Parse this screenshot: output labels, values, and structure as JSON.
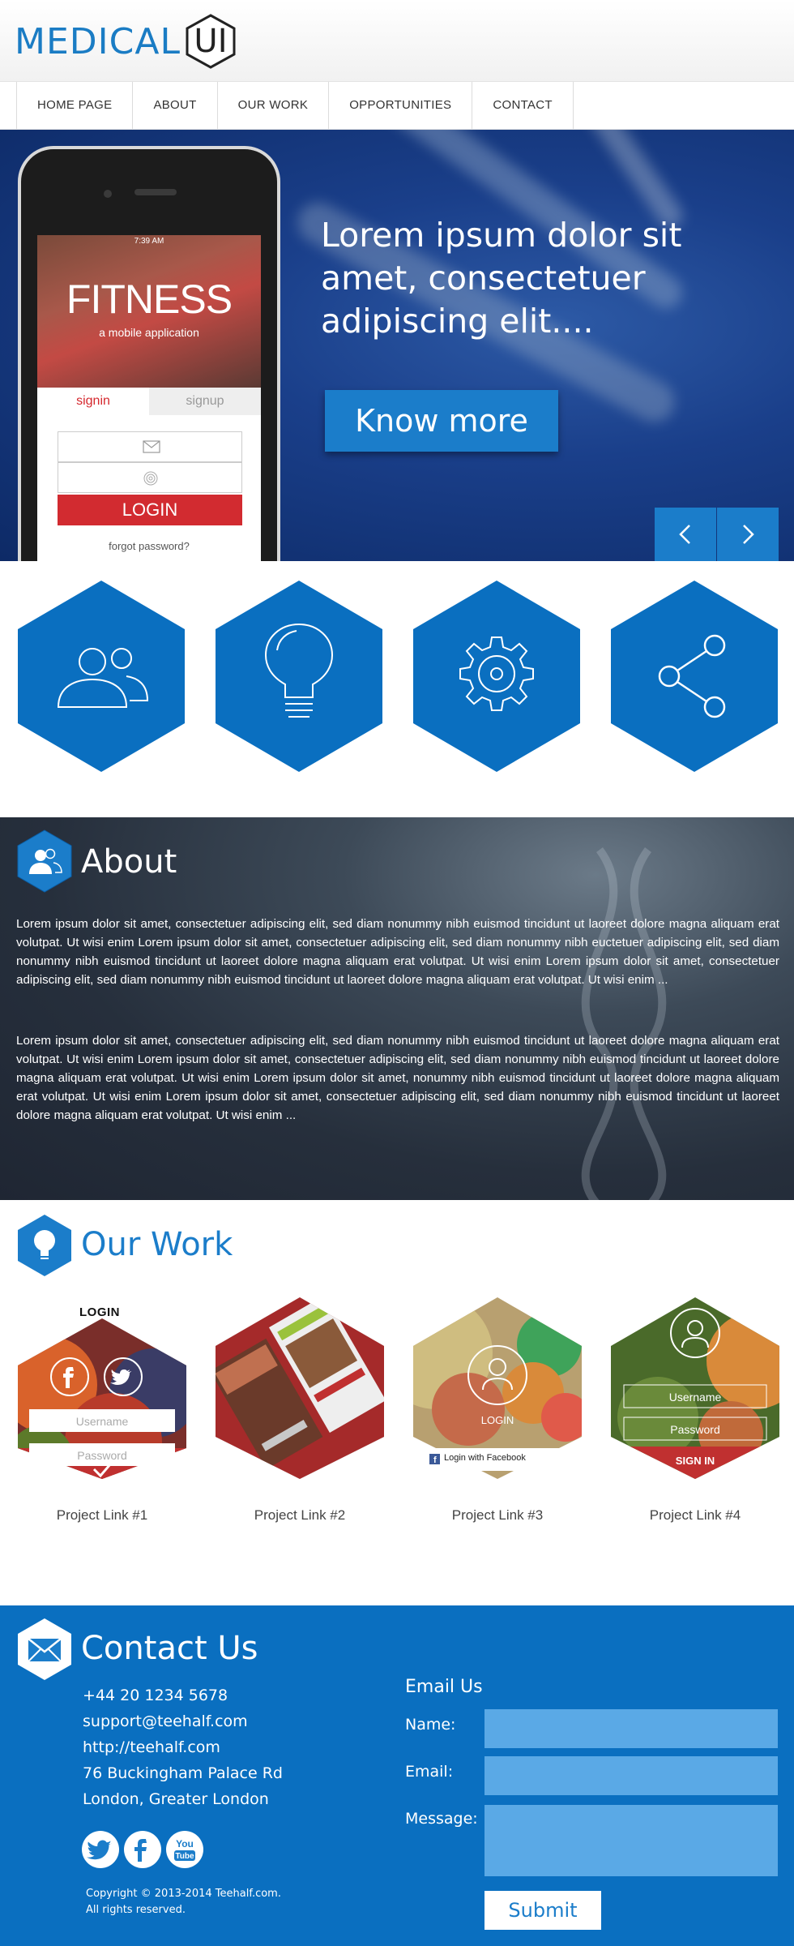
{
  "header": {
    "logo_text": "MEDICAL",
    "logo_badge": "UI"
  },
  "nav": {
    "items": [
      "HOME PAGE",
      "ABOUT",
      "OUR WORK",
      "OPPORTUNITIES",
      "CONTACT"
    ]
  },
  "hero": {
    "headline": "Lorem ipsum dolor sit amet, consectetuer adipiscing elit....",
    "cta_label": "Know more",
    "phone": {
      "time": "7:39 AM",
      "app_title": "FITNESS",
      "app_subtitle": "a mobile application",
      "tab_signin": "signin",
      "tab_signup": "signup",
      "login_label": "LOGIN",
      "forgot_label": "forgot password?"
    }
  },
  "features": {
    "icons": [
      "users-icon",
      "lightbulb-icon",
      "gear-icon",
      "share-icon"
    ],
    "color": "#0a6fc0"
  },
  "about": {
    "title": "About",
    "paragraphs": [
      "Lorem ipsum dolor sit amet, consectetuer adipiscing elit, sed diam nonummy nibh euismod tincidunt ut laoreet dolore magna aliquam erat volutpat. Ut wisi enim Lorem ipsum dolor sit amet, consectetuer adipiscing elit, sed diam nonummy nibh euctetuer adipiscing elit, sed diam nonummy nibh euismod tincidunt ut laoreet dolore magna aliquam erat volutpat. Ut wisi enim Lorem ipsum dolor sit amet, consectetuer adipiscing elit, sed diam nonummy nibh euismod tincidunt ut laoreet dolore magna aliquam erat volutpat. Ut wisi enim ...",
      "Lorem ipsum dolor sit amet, consectetuer adipiscing elit, sed diam nonummy nibh euismod tincidunt ut laoreet dolore magna aliquam erat volutpat. Ut wisi enim Lorem ipsum dolor sit amet, consectetuer adipiscing elit, sed diam nonummy nibh euismod tincidunt ut laoreet dolore magna aliquam erat volutpat. Ut wisi enim Lorem ipsum dolor sit amet, nonummy nibh euismod tincidunt ut laoreet dolore magna aliquam erat volutpat. Ut wisi enim Lorem ipsum dolor sit amet, consectetuer adipiscing elit, sed diam nonummy nibh euismod tincidunt ut laoreet dolore magna aliquam erat volutpat. Ut wisi enim ..."
    ]
  },
  "work": {
    "title": "Our Work",
    "p1": {
      "login_title": "LOGIN",
      "username": "Username",
      "password": "Password"
    },
    "p3": {
      "login": "LOGIN",
      "facebook": "Login with Facebook"
    },
    "p4": {
      "username": "Username",
      "password": "Password",
      "sign_in": "SIGN IN"
    },
    "links": [
      "Project Link #1",
      "Project Link #2",
      "Project Link #3",
      "Project Link #4"
    ]
  },
  "contact": {
    "title": "Contact Us",
    "phone": "+44 20 1234 5678",
    "email": "support@teehalf.com",
    "website": "http://teehalf.com",
    "address1": "76 Buckingham Palace Rd",
    "address2": "London, Greater London",
    "copyright1": "Copyright © 2013-2014 Teehalf.com.",
    "copyright2": "All rights reserved.",
    "youtube_top": "You",
    "youtube_bottom": "Tube",
    "form": {
      "title": "Email Us",
      "name_label": "Name:",
      "email_label": "Email:",
      "message_label": "Message:",
      "name_value": "",
      "email_value": "",
      "message_value": "",
      "submit_label": "Submit"
    }
  },
  "colors": {
    "brand_blue": "#1b7dca",
    "login_red": "#d22b30",
    "contact_bg": "#0a6fc0"
  }
}
